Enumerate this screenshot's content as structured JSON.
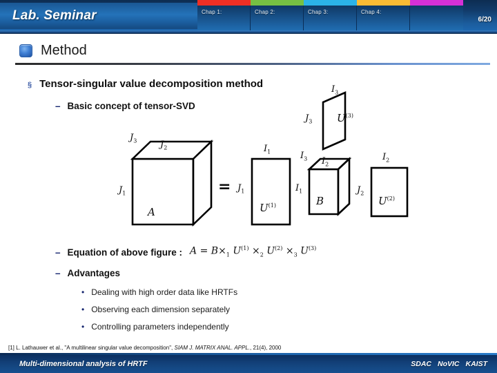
{
  "header": {
    "lab_title": "Lab. Seminar",
    "page_number": "6/20",
    "chapters": [
      {
        "label": "Chap 1:",
        "color": "#ee2f24"
      },
      {
        "label": "Chap 2:",
        "color": "#76c043"
      },
      {
        "label": "Chap 3:",
        "color": "#2bb3e8"
      },
      {
        "label": "Chap 4:",
        "color": "#f9bb34"
      },
      {
        "label": "",
        "color": "#d630d6"
      }
    ]
  },
  "section": {
    "title": "Method"
  },
  "content": {
    "bullet1": "Tensor-singular value decomposition method",
    "bullet1_marker": "§",
    "sub1": "Basic concept of tensor-SVD",
    "sub2": "Equation of above figure :",
    "sub3": "Advantages",
    "dash_marker": "–",
    "dot_marker": "•",
    "advantages": [
      "Dealing with high order data like HRTFs",
      "Observing each dimension separately",
      "Controlling parameters independently"
    ]
  },
  "equation": {
    "lhs": "A",
    "eq": "=",
    "core": "B",
    "term1_op": "×",
    "term1_sub": "1",
    "term1_sym": "U",
    "term1_sup": "(1)",
    "term2_op": "×",
    "term2_sub": "2",
    "term2_sym": "U",
    "term2_sup": "(2)",
    "term3_op": "×",
    "term3_sub": "3",
    "term3_sym": "U",
    "term3_sup": "(3)"
  },
  "figure": {
    "equals": "=",
    "tensor_a": {
      "name": "A",
      "dim_depth": "J",
      "dim_depth_sub": "3",
      "dim_top": "J",
      "dim_top_sub": "2",
      "dim_side": "J",
      "dim_side_sub": "1"
    },
    "u1": {
      "name": "U",
      "sup": "(1)",
      "dim_top": "I",
      "dim_top_sub": "1",
      "dim_side": "J",
      "dim_side_sub": "1"
    },
    "core_b": {
      "name": "B",
      "dim_depth": "I",
      "dim_depth_sub": "3",
      "dim_top": "I",
      "dim_top_sub": "2",
      "dim_side": "I",
      "dim_side_sub": "1"
    },
    "u2": {
      "name": "U",
      "sup": "(2)",
      "dim_top": "I",
      "dim_top_sub": "2",
      "dim_side": "J",
      "dim_side_sub": "2"
    },
    "u3": {
      "name": "U",
      "sup": "(3)",
      "dim_top": "I",
      "dim_top_sub": "3",
      "dim_side": "J",
      "dim_side_sub": "3"
    }
  },
  "footnote": {
    "ref": "[1] L. Lathauwer et al., \"A multilinear singular value decomposition\", ",
    "journal": "SIAM J. MATRIX ANAL. APPL.",
    "tail": ", 21(4), 2000"
  },
  "footer": {
    "left": "Multi-dimensional analysis of HRTF",
    "org1": "SDAC",
    "org2": "NoVIC",
    "org3": "KAIST"
  }
}
